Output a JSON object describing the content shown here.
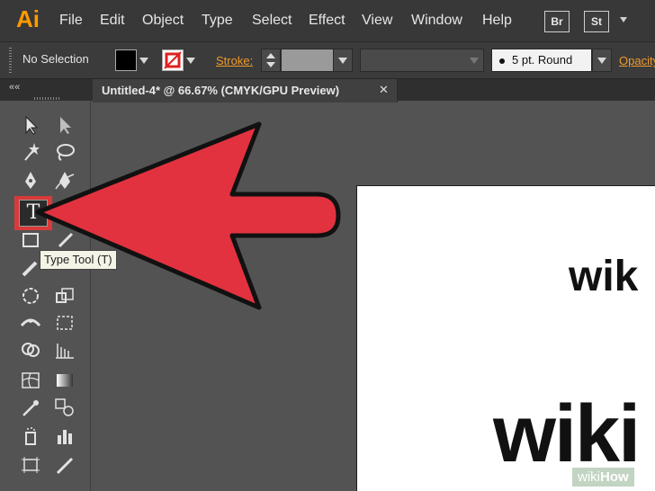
{
  "app": {
    "logo": "Ai",
    "menu": [
      "File",
      "Edit",
      "Object",
      "Type",
      "Select",
      "Effect",
      "View",
      "Window",
      "Help"
    ],
    "bridge_buttons": [
      "Br",
      "St"
    ]
  },
  "control_bar": {
    "selection_status": "No Selection",
    "stroke_label": "Stroke:",
    "brush_value": "5 pt. Round",
    "opacity_label": "Opacity"
  },
  "document_tab": {
    "title": "Untitled-4* @ 66.67% (CMYK/GPU Preview)",
    "close_glyph": "✕"
  },
  "panel": {
    "collapse_glyph": "««"
  },
  "toolbar": {
    "type_tool_glyph": "T",
    "tooltip": "Type Tool (T)",
    "highlight_color": "#d83a3a"
  },
  "canvas": {
    "text_small": "wik",
    "text_big": "wiki"
  },
  "overlay": {
    "arrow_color": "#e2323f",
    "watermark_prefix": "wiki",
    "watermark_suffix": "How"
  }
}
